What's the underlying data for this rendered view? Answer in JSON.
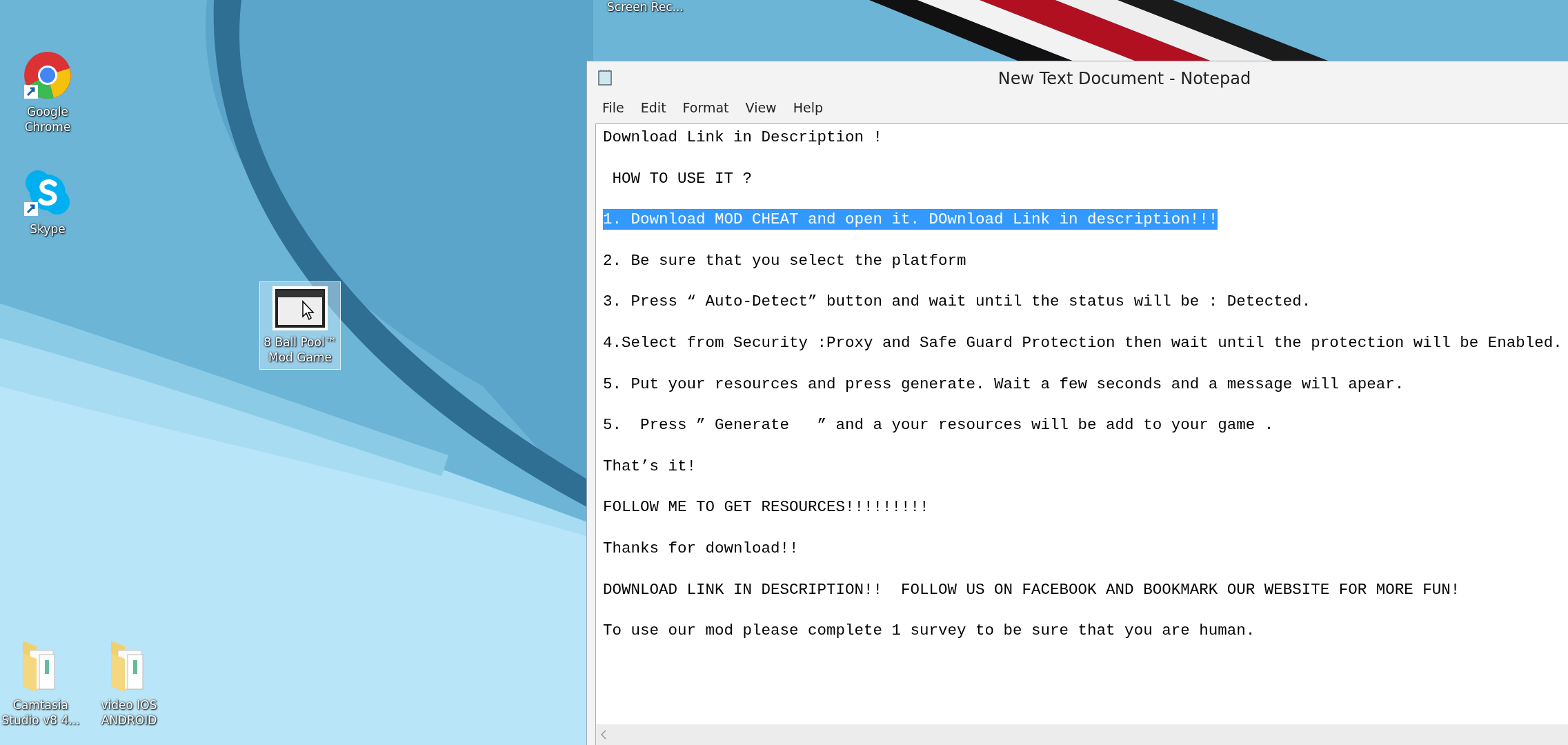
{
  "desktop": {
    "top_label": "Screen Rec...",
    "icons": [
      {
        "kind": "browser",
        "label_lines": [
          "Google",
          "Chrome"
        ],
        "selected": false
      },
      {
        "kind": "chat",
        "label_lines": [
          "Skype"
        ],
        "selected": false
      },
      {
        "kind": "app",
        "label_lines": [
          "8 Ball Pool™",
          "Mod Game"
        ],
        "selected": true
      },
      {
        "kind": "folder",
        "label_lines": [
          "Camtasia",
          "Studio v8 4..."
        ],
        "selected": false
      },
      {
        "kind": "folder",
        "label_lines": [
          "video IOS",
          "ANDROID"
        ],
        "selected": false
      }
    ]
  },
  "window": {
    "title": "New Text Document - Notepad",
    "menu": [
      "File",
      "Edit",
      "Format",
      "View",
      "Help"
    ],
    "lines": [
      {
        "text": "Download Link in Description !",
        "selected": false
      },
      {
        "text": " HOW TO USE IT ?",
        "selected": false
      },
      {
        "text": "1. Download MOD CHEAT and open it. DOwnload Link in description!!!",
        "selected": true
      },
      {
        "text": "2. Be sure that you select the platform",
        "selected": false
      },
      {
        "text": "3. Press “ Auto-Detect” button and wait until the status will be : Detected.",
        "selected": false
      },
      {
        "text": "4.Select from Security :Proxy and Safe Guard Protection then wait until the protection will be Enabled.",
        "selected": false
      },
      {
        "text": "5. Put your resources and press generate. Wait a few seconds and a message will apear.",
        "selected": false
      },
      {
        "text": "5.  Press ” Generate   ” and a your resources will be add to your game .",
        "selected": false
      },
      {
        "text": "That’s it!",
        "selected": false
      },
      {
        "text": "FOLLOW ME TO GET RESOURCES!!!!!!!!!",
        "selected": false
      },
      {
        "text": "Thanks for download!!",
        "selected": false
      },
      {
        "text": "DOWNLOAD LINK IN DESCRIPTION!!  FOLLOW US ON FACEBOOK AND BOOKMARK OUR WEBSITE FOR MORE FUN!",
        "selected": false
      },
      {
        "text": "To use our mod please complete 1 survey to be sure that you are human.",
        "selected": false
      }
    ]
  }
}
